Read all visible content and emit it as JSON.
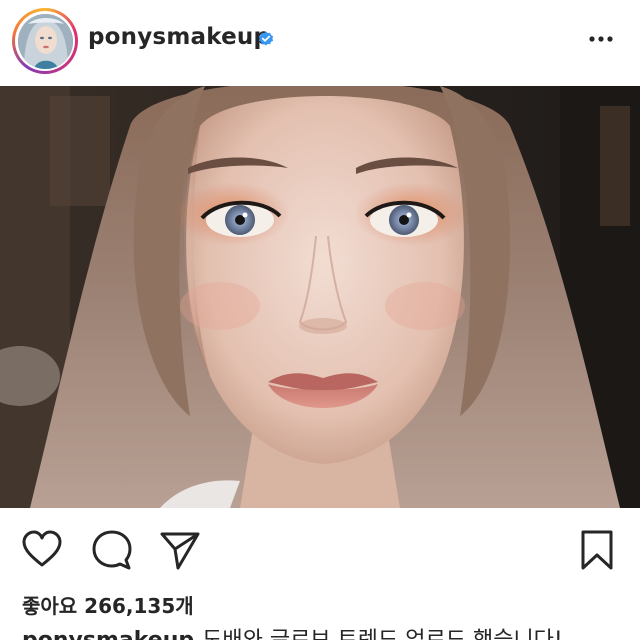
{
  "post": {
    "username": "ponysmakeup",
    "verified": true,
    "likes_label": "좋아요",
    "likes_count": "266,135개",
    "caption_user": "ponysmakeup",
    "caption_text": "도배와 글로브 트렌드 업로드 했습니다!"
  },
  "icons": {
    "more": "more-dots-icon",
    "like": "heart-icon",
    "comment": "comment-icon",
    "share": "send-icon",
    "save": "bookmark-icon",
    "verified": "verified-badge-icon"
  },
  "colors": {
    "verified_blue": "#3897f0",
    "text": "#262626",
    "ring_start": "#f7b733",
    "ring_end": "#833ab4"
  }
}
